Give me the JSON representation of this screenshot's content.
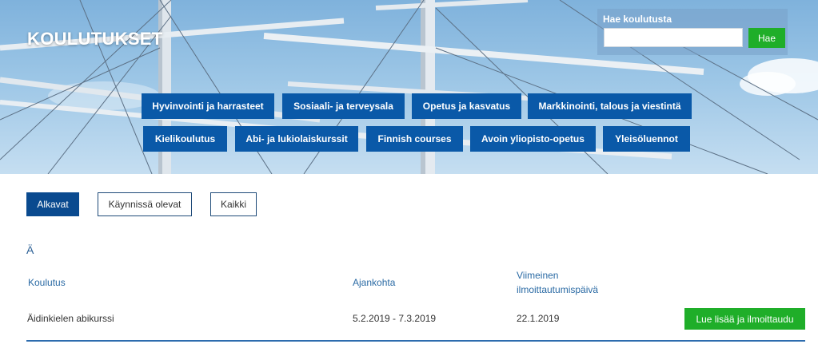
{
  "hero": {
    "title": "KOULUTUKSET",
    "search": {
      "label": "Hae koulutusta",
      "value": "",
      "placeholder": "",
      "button": "Hae"
    },
    "categories_row1": [
      "Hyvinvointi ja harrasteet",
      "Sosiaali- ja terveysala",
      "Opetus ja kasvatus",
      "Markkinointi, talous ja viestintä"
    ],
    "categories_row2": [
      "Kielikoulutus",
      "Abi- ja lukiolaiskurssit",
      "Finnish courses",
      "Avoin yliopisto-opetus",
      "Yleisöluennot"
    ]
  },
  "filters": [
    "Alkavat",
    "Käynnissä olevat",
    "Kaikki"
  ],
  "active_filter": "Alkavat",
  "section_letter": "Ä",
  "table": {
    "headers": {
      "course": "Koulutus",
      "period": "Ajankohta",
      "deadline_line1": "Viimeinen",
      "deadline_line2": "ilmoittautumispäivä"
    },
    "rows": [
      {
        "course": "Äidinkielen abikurssi",
        "period": "5.2.2019 - 7.3.2019",
        "deadline": "22.1.2019",
        "action": "Lue lisää ja ilmoittaudu"
      }
    ]
  },
  "colors": {
    "primary_blue": "#0a59a8",
    "green": "#1fae29",
    "header_text": "#2a6aa4"
  }
}
